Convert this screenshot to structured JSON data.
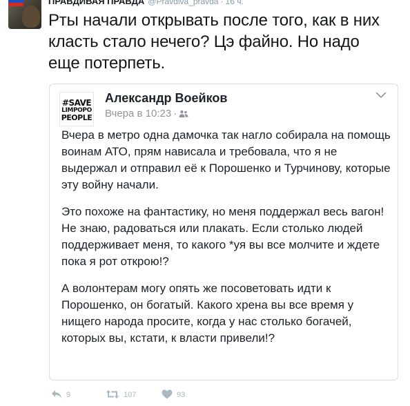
{
  "tweet": {
    "author_name": "ПРАВДИВАЯ ПРАВДА",
    "author_handle": "@Pravdiva_pravda",
    "separator": "·",
    "time": "16 ч.",
    "text": "Рты начали открывать после того, как в них класть стало нечего? Цэ файно. Но надо еще потерпеть."
  },
  "quote": {
    "avatar_lines": [
      "#SAVE",
      "LIMPOPO",
      "PEOPLE"
    ],
    "author_name": "Александр Воейков",
    "time": "Вчера в 10:23",
    "separator": "·",
    "paragraphs": [
      "Вчера в метро одна дамочка так нагло собирала на помощь воинам АТО, прям нависала и требовала, что я не выдержал и отправил её к Порошенко и Турчинову, которые эту войну начали.",
      "Это похоже на фантастику, но меня поддержал весь вагон! Не знаю, радоваться или плакать. Если столько людей поддерживает меня, то какого *уя вы все молчите и ждете пока я рот открою!?",
      "А волонтерам могу опять же посоветовать идти к Порошенко, он богатый. Какого хрена вы все время у нищего народа просите, когда у нас столько богачей, которых вы, кстати, к власти привели!?"
    ]
  },
  "actions": {
    "reply_count": "9",
    "retweet_count": "107",
    "like_count": "93"
  },
  "icons": {
    "avatar_flag": "russian-flag",
    "privacy": "friends-icon",
    "menu": "chevron-down-icon",
    "reply": "reply-icon",
    "retweet": "retweet-icon",
    "like": "heart-icon"
  },
  "colors": {
    "text": "#14171a",
    "muted": "#8899a6",
    "action": "#aab8c2",
    "quote_border": "#d7dde2",
    "fb_name": "#1d2129",
    "fb_meta": "#90949c"
  }
}
